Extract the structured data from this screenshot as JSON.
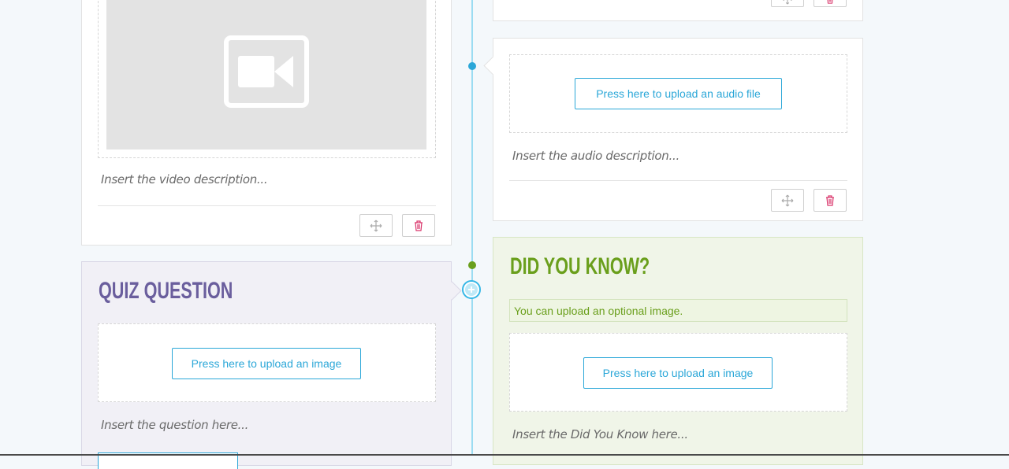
{
  "video_card": {
    "icon": "video-camera-icon",
    "description_placeholder": "Insert the video description..."
  },
  "audio_card": {
    "upload_label": "Press here to upload an audio file",
    "description_placeholder": "Insert the audio description..."
  },
  "quiz_card": {
    "title": "QUIZ QUESTION",
    "upload_label": "Press here to upload an image",
    "question_placeholder": "Insert the question here..."
  },
  "did_you_know_card": {
    "title": "DID YOU KNOW?",
    "hint": "You can upload an optional image.",
    "upload_label": "Press here to upload an image",
    "text_placeholder": "Insert the Did You Know here..."
  },
  "colors": {
    "accent_blue": "#2ba7d8",
    "quiz_purple": "#6a5e9d",
    "dyk_green": "#6a9f1c",
    "delete_red": "#d9346a"
  }
}
